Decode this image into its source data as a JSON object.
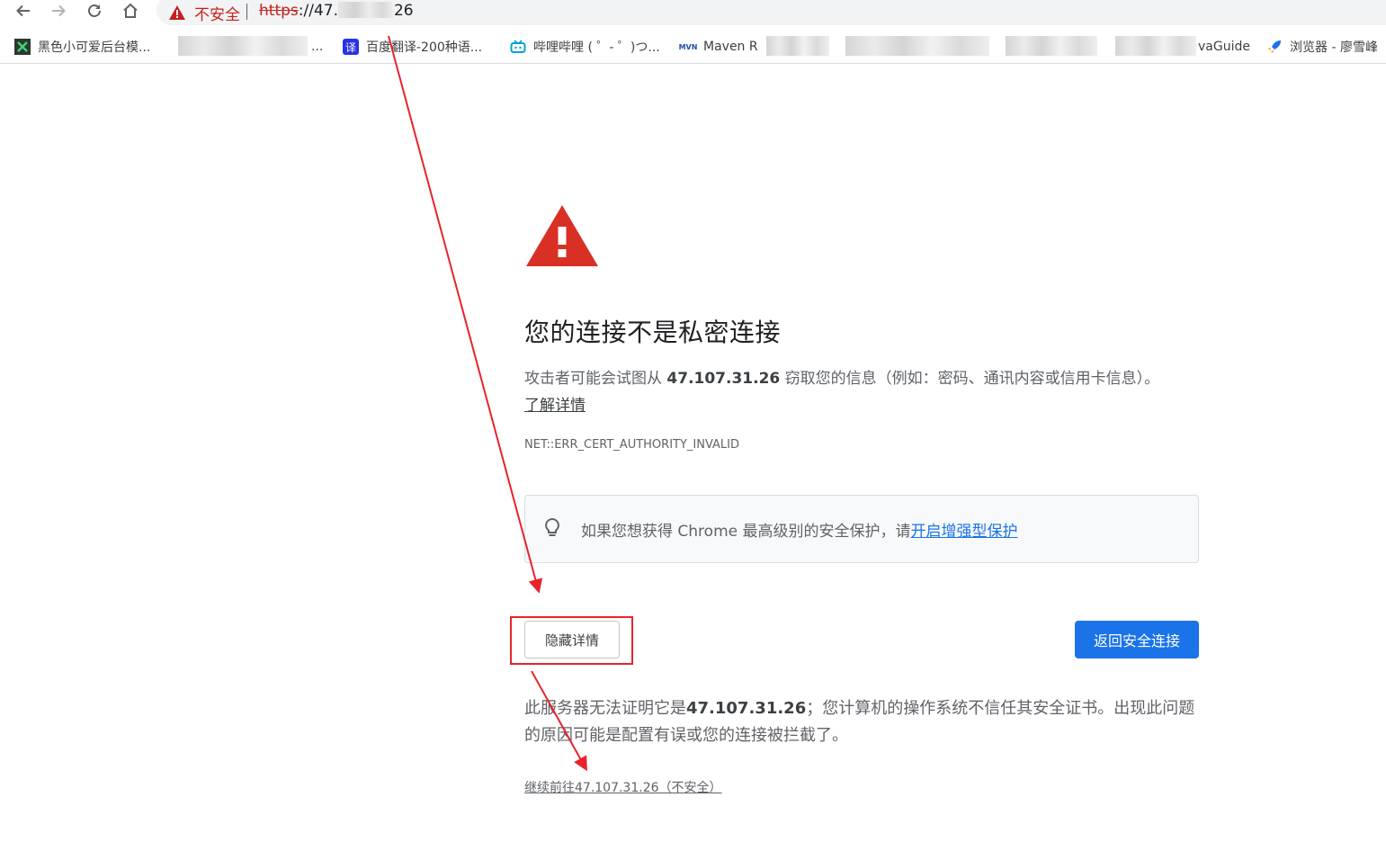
{
  "browser": {
    "nav": {
      "back_icon": "arrow-left-icon",
      "forward_icon": "arrow-right-icon",
      "reload_icon": "reload-icon",
      "home_icon": "home-icon"
    },
    "omnibox": {
      "security_text": "不安全",
      "url_scheme": "https",
      "url_start": "://47.",
      "url_end": "26"
    },
    "bookmarks": [
      {
        "label": "黑色小可爱后台模...",
        "icon": "dashboard-icon"
      },
      {
        "label": "...",
        "icon": ""
      },
      {
        "label": "百度翻译-200种语...",
        "icon": "translate-icon"
      },
      {
        "label": "哔哩哔哩 ( ゜- ゜)つ...",
        "icon": "bilibili-icon"
      },
      {
        "label": "Maven R",
        "icon": "maven-icon"
      },
      {
        "label": "vaGuide",
        "icon": ""
      },
      {
        "label": "浏览器 - 廖雪峰",
        "icon": "rocket-icon"
      }
    ]
  },
  "interstitial": {
    "heading": "您的连接不是私密连接",
    "desc_before": "攻击者可能会试图从 ",
    "host": "47.107.31.26",
    "desc_after": " 窃取您的信息（例如：密码、通讯内容或信用卡信息）。",
    "learn_more": "了解详情",
    "error_code": "NET::ERR_CERT_AUTHORITY_INVALID",
    "tip_text": "如果您想获得 Chrome 最高级别的安全保护，请",
    "tip_link": "开启增强型保护",
    "hide_details_button": "隐藏详情",
    "back_button": "返回安全连接",
    "details_before": "此服务器无法证明它是",
    "details_after": "；您计算机的操作系统不信任其安全证书。出现此问题的原因可能是配置有误或您的连接被拦截了。",
    "proceed_link": "继续前往47.107.31.26（不安全）"
  },
  "annotation": {
    "color": "#e8242a"
  },
  "colors": {
    "primary": "#1a73e8",
    "danger": "#d93025"
  }
}
